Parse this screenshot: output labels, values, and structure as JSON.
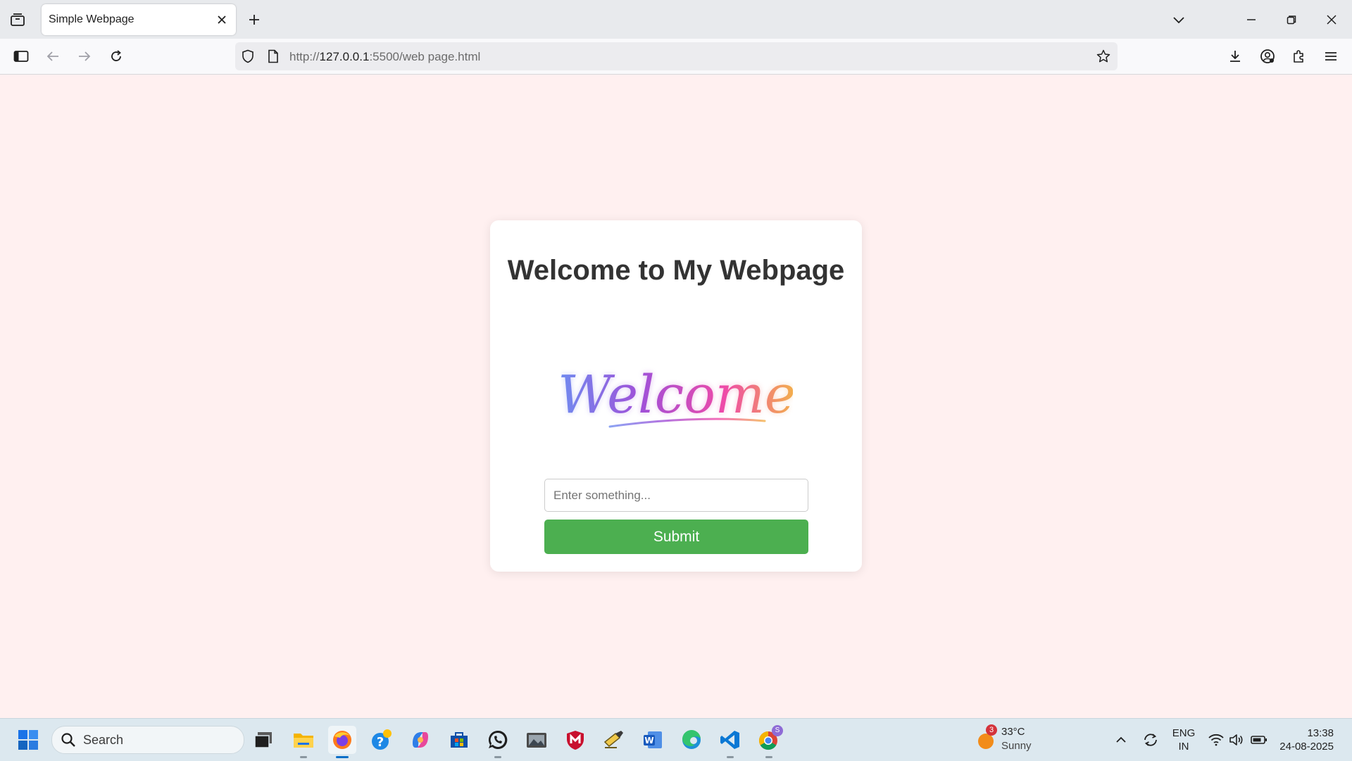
{
  "browser": {
    "tab_title": "Simple Webpage",
    "url_scheme": "http://",
    "url_host": "127.0.0.1",
    "url_rest": ":5500/web page.html"
  },
  "page": {
    "heading": "Welcome to My Webpage",
    "image_text": "Welcome",
    "input_placeholder": "Enter something...",
    "input_value": "",
    "submit_label": "Submit",
    "background_color": "#fff0f0",
    "button_color": "#4caf50"
  },
  "taskbar": {
    "search_label": "Search",
    "weather_temp": "33°C",
    "weather_condition": "Sunny",
    "weather_badge": "3",
    "chrome_badge": "S",
    "lang_line1": "ENG",
    "lang_line2": "IN",
    "time": "13:38",
    "date": "24-08-2025",
    "icons": [
      "windows-start-icon",
      "search-icon",
      "task-view-icon",
      "file-explorer-icon",
      "firefox-icon",
      "get-help-icon",
      "copilot-icon",
      "microsoft-store-icon",
      "whatsapp-icon",
      "photos-icon",
      "mcafee-icon",
      "notepad-icon",
      "word-icon",
      "edge-icon",
      "vscode-icon",
      "chrome-icon"
    ]
  }
}
